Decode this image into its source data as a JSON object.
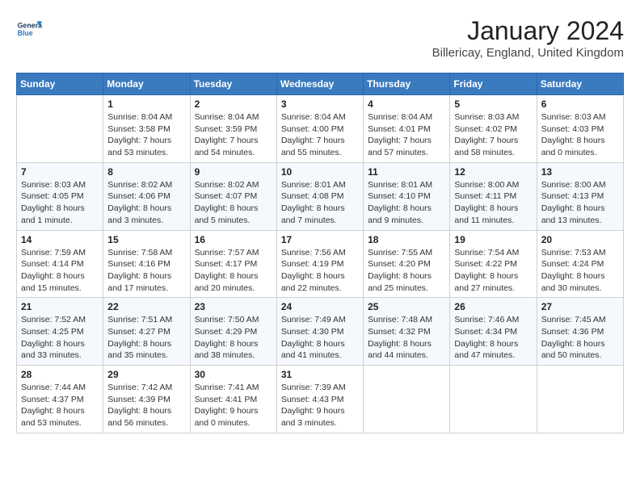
{
  "header": {
    "logo_general": "General",
    "logo_blue": "Blue",
    "month_title": "January 2024",
    "location": "Billericay, England, United Kingdom"
  },
  "calendar": {
    "days_of_week": [
      "Sunday",
      "Monday",
      "Tuesday",
      "Wednesday",
      "Thursday",
      "Friday",
      "Saturday"
    ],
    "weeks": [
      [
        {
          "day": "",
          "sunrise": "",
          "sunset": "",
          "daylight": ""
        },
        {
          "day": "1",
          "sunrise": "Sunrise: 8:04 AM",
          "sunset": "Sunset: 3:58 PM",
          "daylight": "Daylight: 7 hours and 53 minutes."
        },
        {
          "day": "2",
          "sunrise": "Sunrise: 8:04 AM",
          "sunset": "Sunset: 3:59 PM",
          "daylight": "Daylight: 7 hours and 54 minutes."
        },
        {
          "day": "3",
          "sunrise": "Sunrise: 8:04 AM",
          "sunset": "Sunset: 4:00 PM",
          "daylight": "Daylight: 7 hours and 55 minutes."
        },
        {
          "day": "4",
          "sunrise": "Sunrise: 8:04 AM",
          "sunset": "Sunset: 4:01 PM",
          "daylight": "Daylight: 7 hours and 57 minutes."
        },
        {
          "day": "5",
          "sunrise": "Sunrise: 8:03 AM",
          "sunset": "Sunset: 4:02 PM",
          "daylight": "Daylight: 7 hours and 58 minutes."
        },
        {
          "day": "6",
          "sunrise": "Sunrise: 8:03 AM",
          "sunset": "Sunset: 4:03 PM",
          "daylight": "Daylight: 8 hours and 0 minutes."
        }
      ],
      [
        {
          "day": "7",
          "sunrise": "Sunrise: 8:03 AM",
          "sunset": "Sunset: 4:05 PM",
          "daylight": "Daylight: 8 hours and 1 minute."
        },
        {
          "day": "8",
          "sunrise": "Sunrise: 8:02 AM",
          "sunset": "Sunset: 4:06 PM",
          "daylight": "Daylight: 8 hours and 3 minutes."
        },
        {
          "day": "9",
          "sunrise": "Sunrise: 8:02 AM",
          "sunset": "Sunset: 4:07 PM",
          "daylight": "Daylight: 8 hours and 5 minutes."
        },
        {
          "day": "10",
          "sunrise": "Sunrise: 8:01 AM",
          "sunset": "Sunset: 4:08 PM",
          "daylight": "Daylight: 8 hours and 7 minutes."
        },
        {
          "day": "11",
          "sunrise": "Sunrise: 8:01 AM",
          "sunset": "Sunset: 4:10 PM",
          "daylight": "Daylight: 8 hours and 9 minutes."
        },
        {
          "day": "12",
          "sunrise": "Sunrise: 8:00 AM",
          "sunset": "Sunset: 4:11 PM",
          "daylight": "Daylight: 8 hours and 11 minutes."
        },
        {
          "day": "13",
          "sunrise": "Sunrise: 8:00 AM",
          "sunset": "Sunset: 4:13 PM",
          "daylight": "Daylight: 8 hours and 13 minutes."
        }
      ],
      [
        {
          "day": "14",
          "sunrise": "Sunrise: 7:59 AM",
          "sunset": "Sunset: 4:14 PM",
          "daylight": "Daylight: 8 hours and 15 minutes."
        },
        {
          "day": "15",
          "sunrise": "Sunrise: 7:58 AM",
          "sunset": "Sunset: 4:16 PM",
          "daylight": "Daylight: 8 hours and 17 minutes."
        },
        {
          "day": "16",
          "sunrise": "Sunrise: 7:57 AM",
          "sunset": "Sunset: 4:17 PM",
          "daylight": "Daylight: 8 hours and 20 minutes."
        },
        {
          "day": "17",
          "sunrise": "Sunrise: 7:56 AM",
          "sunset": "Sunset: 4:19 PM",
          "daylight": "Daylight: 8 hours and 22 minutes."
        },
        {
          "day": "18",
          "sunrise": "Sunrise: 7:55 AM",
          "sunset": "Sunset: 4:20 PM",
          "daylight": "Daylight: 8 hours and 25 minutes."
        },
        {
          "day": "19",
          "sunrise": "Sunrise: 7:54 AM",
          "sunset": "Sunset: 4:22 PM",
          "daylight": "Daylight: 8 hours and 27 minutes."
        },
        {
          "day": "20",
          "sunrise": "Sunrise: 7:53 AM",
          "sunset": "Sunset: 4:24 PM",
          "daylight": "Daylight: 8 hours and 30 minutes."
        }
      ],
      [
        {
          "day": "21",
          "sunrise": "Sunrise: 7:52 AM",
          "sunset": "Sunset: 4:25 PM",
          "daylight": "Daylight: 8 hours and 33 minutes."
        },
        {
          "day": "22",
          "sunrise": "Sunrise: 7:51 AM",
          "sunset": "Sunset: 4:27 PM",
          "daylight": "Daylight: 8 hours and 35 minutes."
        },
        {
          "day": "23",
          "sunrise": "Sunrise: 7:50 AM",
          "sunset": "Sunset: 4:29 PM",
          "daylight": "Daylight: 8 hours and 38 minutes."
        },
        {
          "day": "24",
          "sunrise": "Sunrise: 7:49 AM",
          "sunset": "Sunset: 4:30 PM",
          "daylight": "Daylight: 8 hours and 41 minutes."
        },
        {
          "day": "25",
          "sunrise": "Sunrise: 7:48 AM",
          "sunset": "Sunset: 4:32 PM",
          "daylight": "Daylight: 8 hours and 44 minutes."
        },
        {
          "day": "26",
          "sunrise": "Sunrise: 7:46 AM",
          "sunset": "Sunset: 4:34 PM",
          "daylight": "Daylight: 8 hours and 47 minutes."
        },
        {
          "day": "27",
          "sunrise": "Sunrise: 7:45 AM",
          "sunset": "Sunset: 4:36 PM",
          "daylight": "Daylight: 8 hours and 50 minutes."
        }
      ],
      [
        {
          "day": "28",
          "sunrise": "Sunrise: 7:44 AM",
          "sunset": "Sunset: 4:37 PM",
          "daylight": "Daylight: 8 hours and 53 minutes."
        },
        {
          "day": "29",
          "sunrise": "Sunrise: 7:42 AM",
          "sunset": "Sunset: 4:39 PM",
          "daylight": "Daylight: 8 hours and 56 minutes."
        },
        {
          "day": "30",
          "sunrise": "Sunrise: 7:41 AM",
          "sunset": "Sunset: 4:41 PM",
          "daylight": "Daylight: 9 hours and 0 minutes."
        },
        {
          "day": "31",
          "sunrise": "Sunrise: 7:39 AM",
          "sunset": "Sunset: 4:43 PM",
          "daylight": "Daylight: 9 hours and 3 minutes."
        },
        {
          "day": "",
          "sunrise": "",
          "sunset": "",
          "daylight": ""
        },
        {
          "day": "",
          "sunrise": "",
          "sunset": "",
          "daylight": ""
        },
        {
          "day": "",
          "sunrise": "",
          "sunset": "",
          "daylight": ""
        }
      ]
    ]
  }
}
